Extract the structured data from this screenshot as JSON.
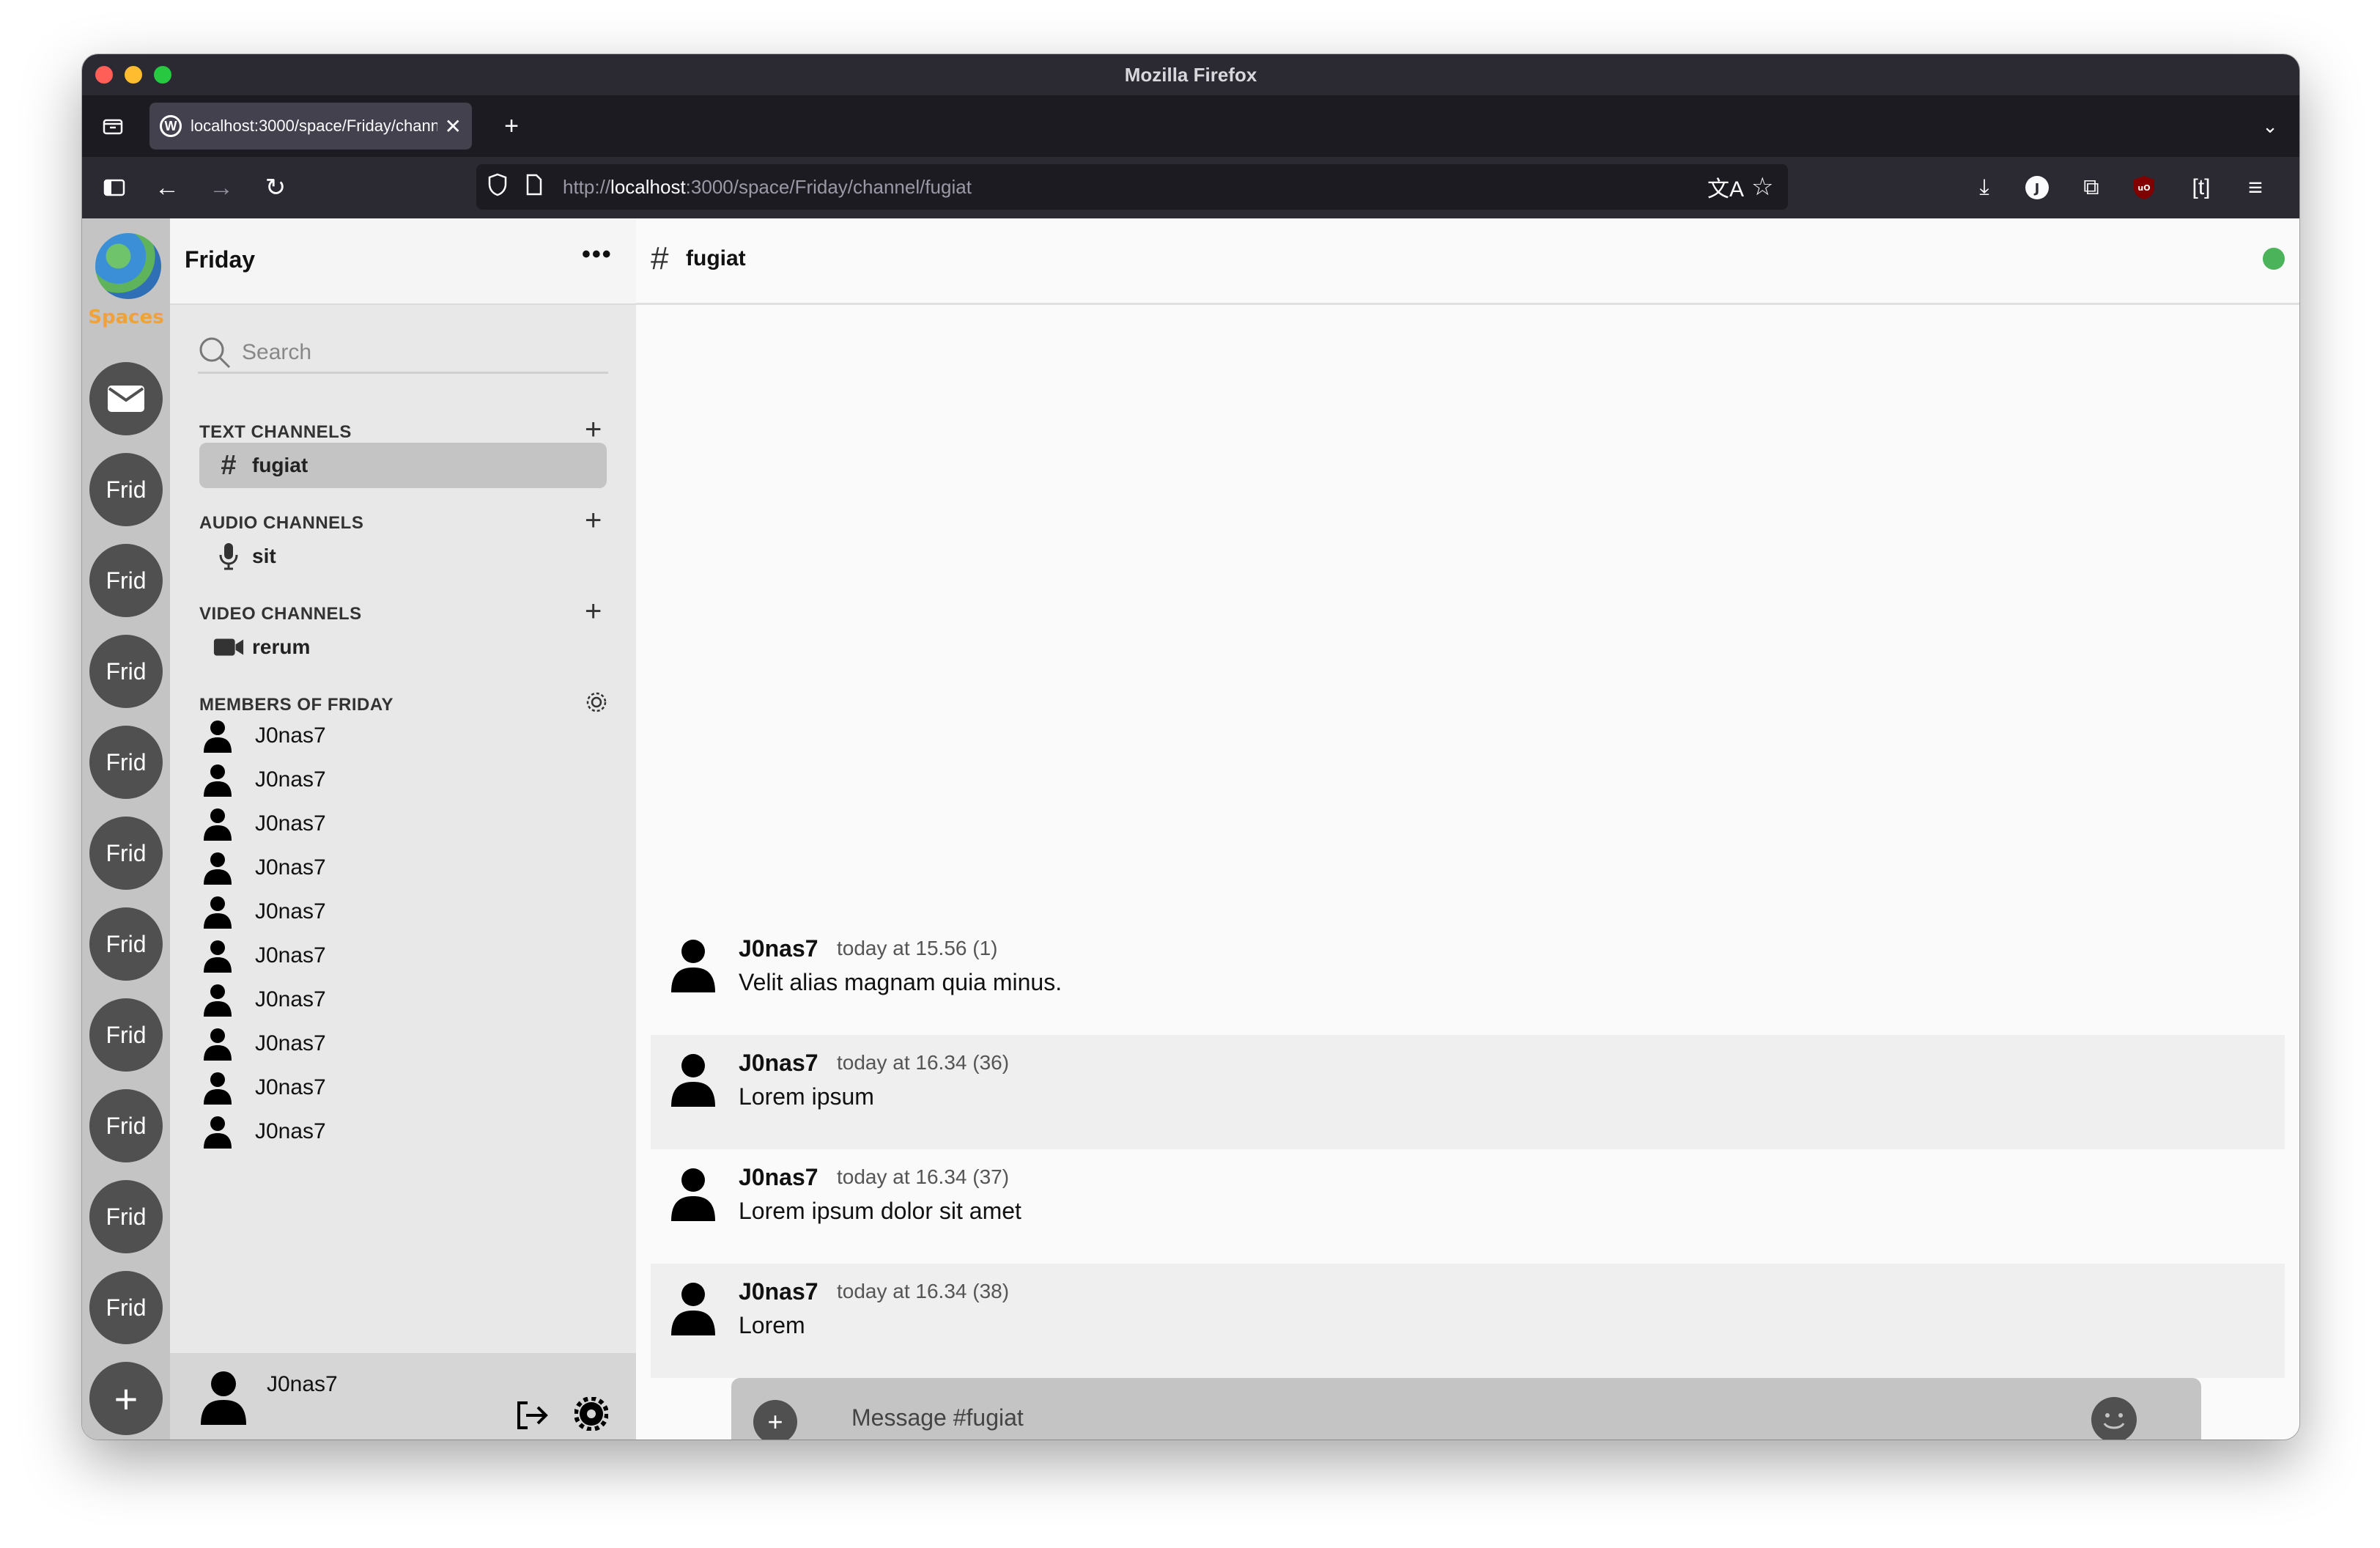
{
  "browser": {
    "title": "Mozilla Firefox",
    "tab_title": "localhost:3000/space/Friday/channel/fugiat",
    "url_prefix": "http://",
    "url_host": "localhost",
    "url_rest": ":3000/space/Friday/channel/fugiat"
  },
  "spaces": {
    "label": "Spaces",
    "items": [
      "Frid",
      "Frid",
      "Frid",
      "Frid",
      "Frid",
      "Frid",
      "Frid",
      "Frid",
      "Frid",
      "Frid"
    ],
    "add_label": "+"
  },
  "space": {
    "name": "Friday",
    "more": "•••",
    "search_placeholder": "Search",
    "text_channels_title": "TEXT CHANNELS",
    "text_channels": [
      "fugiat"
    ],
    "audio_channels_title": "AUDIO CHANNELS",
    "audio_channels": [
      "sit"
    ],
    "video_channels_title": "VIDEO CHANNELS",
    "video_channels": [
      "rerum"
    ],
    "members_title": "MEMBERS OF FRIDAY",
    "members": [
      "J0nas7",
      "J0nas7",
      "J0nas7",
      "J0nas7",
      "J0nas7",
      "J0nas7",
      "J0nas7",
      "J0nas7",
      "J0nas7",
      "J0nas7"
    ]
  },
  "current_user": {
    "name": "J0nas7"
  },
  "chat": {
    "hash": "#",
    "channel": "fugiat",
    "status_color": "#4bb35a",
    "messages": [
      {
        "author": "J0nas7",
        "time": "today at 15.56 (1)",
        "text": "Velit alias magnam quia minus."
      },
      {
        "author": "J0nas7",
        "time": "today at 16.34 (36)",
        "text": "Lorem ipsum"
      },
      {
        "author": "J0nas7",
        "time": "today at 16.34 (37)",
        "text": "Lorem ipsum dolor sit amet"
      },
      {
        "author": "J0nas7",
        "time": "today at 16.34 (38)",
        "text": "Lorem"
      }
    ],
    "composer_placeholder": "Message #fugiat",
    "composer_add": "+"
  }
}
